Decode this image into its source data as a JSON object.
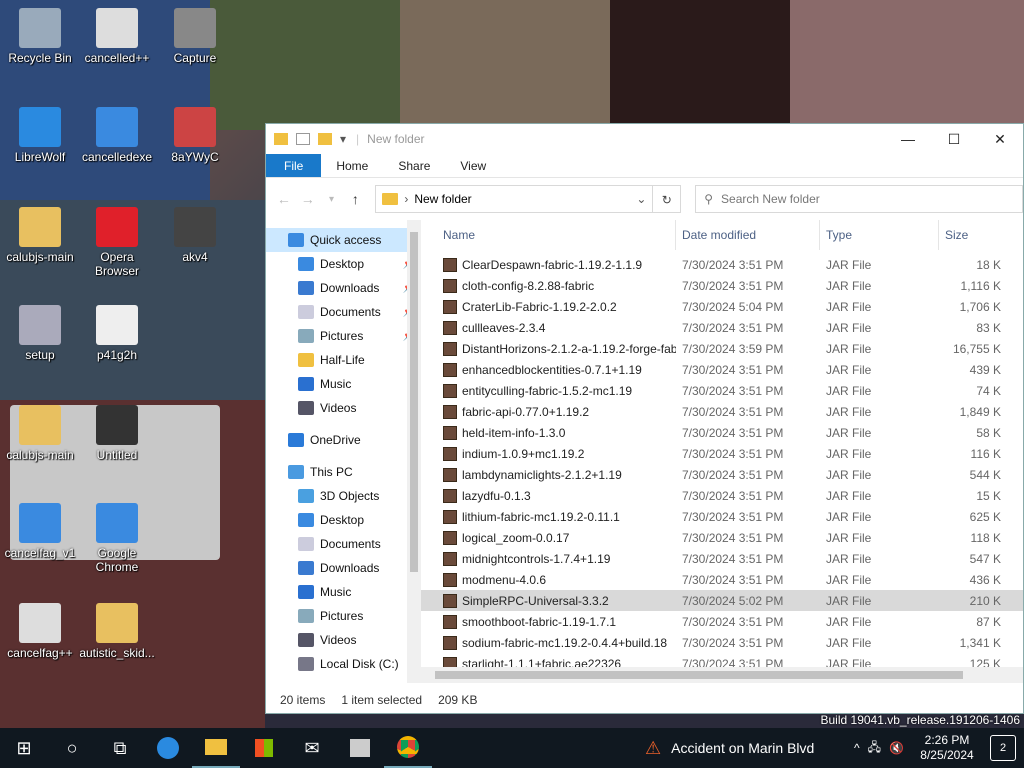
{
  "desktop": {
    "icons": [
      {
        "label": "Recycle Bin",
        "color": "#9ab"
      },
      {
        "label": "cancelled++",
        "color": "#ddd"
      },
      {
        "label": "Capture",
        "color": "#888"
      },
      {
        "label": "LibreWolf",
        "color": "#2a8ae0"
      },
      {
        "label": "cancelledexe",
        "color": "#3a8ae0"
      },
      {
        "label": "8aYWyC",
        "color": "#c44"
      },
      {
        "label": "calubjs-main",
        "color": "#e8c060"
      },
      {
        "label": "Opera Browser",
        "color": "#e0202a"
      },
      {
        "label": "akv4",
        "color": "#444"
      },
      {
        "label": "setup",
        "color": "#aab"
      },
      {
        "label": "p41g2h",
        "color": "#eee"
      },
      {
        "label": "calubjs-main",
        "color": "#e8c060"
      },
      {
        "label": "Untitled",
        "color": "#333"
      },
      {
        "label": "cancelfag_v1",
        "color": "#3a8ae0"
      },
      {
        "label": "Google Chrome",
        "color": "#3a8ae0"
      },
      {
        "label": "cancelfag++",
        "color": "#ddd"
      },
      {
        "label": "autistic_skid...",
        "color": "#e8c060"
      }
    ],
    "build_text": "Build 19041.vb_release.191206-1406"
  },
  "window": {
    "title": "New folder",
    "controls": {
      "minimize": "—",
      "maximize": "☐",
      "close": "✕"
    },
    "ribbon": [
      "File",
      "Home",
      "Share",
      "View"
    ],
    "address": "New folder",
    "search_placeholder": "Search New folder",
    "nav": {
      "quick_access": "Quick access",
      "quick_items": [
        "Desktop",
        "Downloads",
        "Documents",
        "Pictures",
        "Half-Life",
        "Music",
        "Videos"
      ],
      "onedrive": "OneDrive",
      "this_pc": "This PC",
      "pc_items": [
        "3D Objects",
        "Desktop",
        "Documents",
        "Downloads",
        "Music",
        "Pictures",
        "Videos",
        "Local Disk (C:)"
      ]
    },
    "columns": {
      "name": "Name",
      "date": "Date modified",
      "type": "Type",
      "size": "Size"
    },
    "files": [
      {
        "name": "ClearDespawn-fabric-1.19.2-1.1.9",
        "date": "7/30/2024 3:51 PM",
        "type": "JAR File",
        "size": "18 K"
      },
      {
        "name": "cloth-config-8.2.88-fabric",
        "date": "7/30/2024 3:51 PM",
        "type": "JAR File",
        "size": "1,116 K"
      },
      {
        "name": "CraterLib-Fabric-1.19.2-2.0.2",
        "date": "7/30/2024 5:04 PM",
        "type": "JAR File",
        "size": "1,706 K"
      },
      {
        "name": "cullleaves-2.3.4",
        "date": "7/30/2024 3:51 PM",
        "type": "JAR File",
        "size": "83 K"
      },
      {
        "name": "DistantHorizons-2.1.2-a-1.19.2-forge-fab...",
        "date": "7/30/2024 3:59 PM",
        "type": "JAR File",
        "size": "16,755 K"
      },
      {
        "name": "enhancedblockentities-0.7.1+1.19",
        "date": "7/30/2024 3:51 PM",
        "type": "JAR File",
        "size": "439 K"
      },
      {
        "name": "entityculling-fabric-1.5.2-mc1.19",
        "date": "7/30/2024 3:51 PM",
        "type": "JAR File",
        "size": "74 K"
      },
      {
        "name": "fabric-api-0.77.0+1.19.2",
        "date": "7/30/2024 3:51 PM",
        "type": "JAR File",
        "size": "1,849 K"
      },
      {
        "name": "held-item-info-1.3.0",
        "date": "7/30/2024 3:51 PM",
        "type": "JAR File",
        "size": "58 K"
      },
      {
        "name": "indium-1.0.9+mc1.19.2",
        "date": "7/30/2024 3:51 PM",
        "type": "JAR File",
        "size": "116 K"
      },
      {
        "name": "lambdynamiclights-2.1.2+1.19",
        "date": "7/30/2024 3:51 PM",
        "type": "JAR File",
        "size": "544 K"
      },
      {
        "name": "lazydfu-0.1.3",
        "date": "7/30/2024 3:51 PM",
        "type": "JAR File",
        "size": "15 K"
      },
      {
        "name": "lithium-fabric-mc1.19.2-0.11.1",
        "date": "7/30/2024 3:51 PM",
        "type": "JAR File",
        "size": "625 K"
      },
      {
        "name": "logical_zoom-0.0.17",
        "date": "7/30/2024 3:51 PM",
        "type": "JAR File",
        "size": "118 K"
      },
      {
        "name": "midnightcontrols-1.7.4+1.19",
        "date": "7/30/2024 3:51 PM",
        "type": "JAR File",
        "size": "547 K"
      },
      {
        "name": "modmenu-4.0.6",
        "date": "7/30/2024 3:51 PM",
        "type": "JAR File",
        "size": "436 K"
      },
      {
        "name": "SimpleRPC-Universal-3.3.2",
        "date": "7/30/2024 5:02 PM",
        "type": "JAR File",
        "size": "210 K",
        "selected": true
      },
      {
        "name": "smoothboot-fabric-1.19-1.7.1",
        "date": "7/30/2024 3:51 PM",
        "type": "JAR File",
        "size": "87 K"
      },
      {
        "name": "sodium-fabric-mc1.19.2-0.4.4+build.18",
        "date": "7/30/2024 3:51 PM",
        "type": "JAR File",
        "size": "1,341 K"
      },
      {
        "name": "starlight-1.1.1+fabric.ae22326",
        "date": "7/30/2024 3:51 PM",
        "type": "JAR File",
        "size": "125 K"
      }
    ],
    "status": {
      "items": "20 items",
      "selected": "1 item selected",
      "size": "209 KB"
    }
  },
  "taskbar": {
    "news": "Accident on Marin Blvd",
    "time": "2:26 PM",
    "date": "8/25/2024",
    "notifications": "2"
  }
}
